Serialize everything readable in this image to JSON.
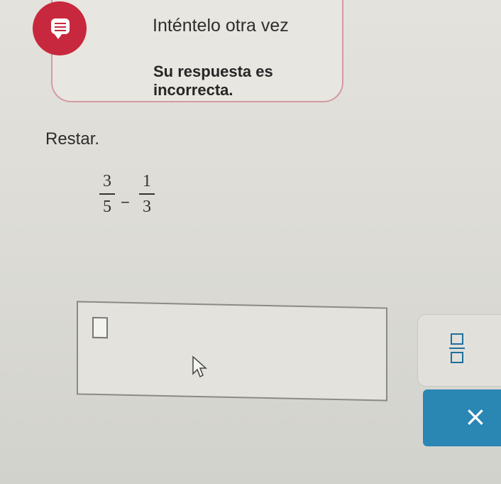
{
  "feedback": {
    "title": "Inténtelo otra vez",
    "message": "Su respuesta es incorrecta.",
    "badge_color": "#c8283d",
    "border_color": "#d59aa4"
  },
  "problem": {
    "instruction": "Restar.",
    "fraction1": {
      "numerator": "3",
      "denominator": "5"
    },
    "operator": "−",
    "fraction2": {
      "numerator": "1",
      "denominator": "3"
    }
  },
  "answer": {
    "value": ""
  },
  "tools": {
    "fraction_icon": "fraction-template-icon",
    "clear_symbol": "×",
    "clear_icon": "close-icon",
    "accent_color": "#2a86b3"
  }
}
